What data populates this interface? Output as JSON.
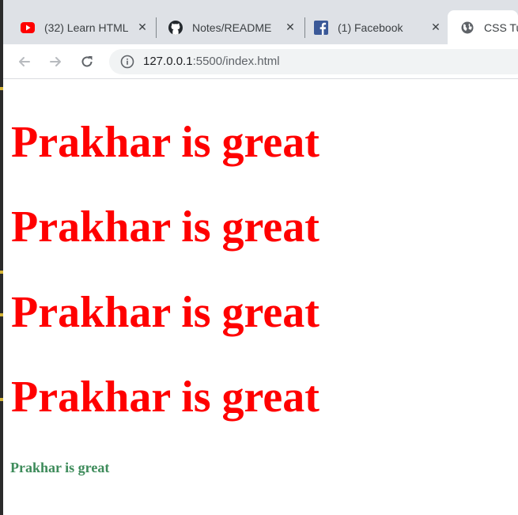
{
  "browser": {
    "tabs": [
      {
        "title": "(32) Learn HTML",
        "icon": "youtube-icon",
        "close": "✕"
      },
      {
        "title": "Notes/README",
        "icon": "github-icon",
        "close": "✕"
      },
      {
        "title": "(1) Facebook",
        "icon": "facebook-icon",
        "close": "✕"
      },
      {
        "title": "CSS Tu",
        "icon": "globe-icon",
        "active": true
      }
    ],
    "url_host": "127.0.0.1",
    "url_path": ":5500/index.html"
  },
  "page": {
    "headings": [
      "Prakhar is great",
      "Prakhar is great",
      "Prakhar is great",
      "Prakhar is great"
    ],
    "small_text": "Prakhar is great"
  },
  "colors": {
    "heading": "#ff0000",
    "small_text": "#3d8b5a",
    "tabbar": "#dee1e6"
  }
}
